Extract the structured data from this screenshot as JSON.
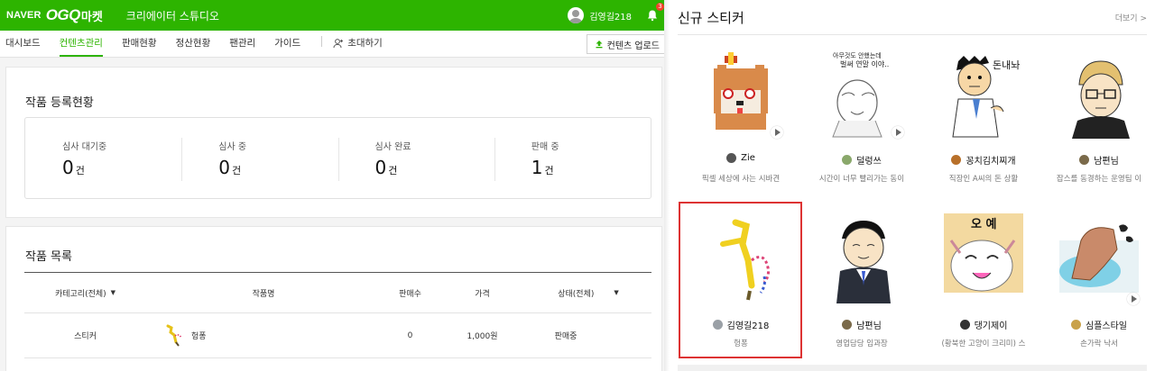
{
  "header": {
    "logo_naver": "NAVER",
    "logo_ogq": "OGQ",
    "logo_market": "마켓",
    "studio_title": "크리에이터 스튜디오",
    "user_name": "김영길218",
    "notification_count": "3"
  },
  "nav": {
    "items": [
      "대시보드",
      "컨텐츠관리",
      "판매현황",
      "정산현황",
      "팬관리",
      "가이드"
    ],
    "active": "컨텐츠관리",
    "invite": "초대하기",
    "upload": "컨텐츠 업로드"
  },
  "status": {
    "title": "작품 등록현황",
    "stats": [
      {
        "label": "심사 대기중",
        "value": "0",
        "unit": "건"
      },
      {
        "label": "심사 중",
        "value": "0",
        "unit": "건"
      },
      {
        "label": "심사 완료",
        "value": "0",
        "unit": "건"
      },
      {
        "label": "판매 중",
        "value": "1",
        "unit": "건"
      }
    ]
  },
  "works": {
    "title": "작품 목록",
    "columns": [
      "카테고리(전체)",
      "작품명",
      "판매수",
      "가격",
      "상태(전체)"
    ],
    "rows": [
      {
        "category": "스티커",
        "name": "헝퐁",
        "sales": "0",
        "price": "1,000원",
        "status": "판매중"
      }
    ]
  },
  "new_stickers": {
    "title": "신규 스티커",
    "more": "더보기 >",
    "items": [
      {
        "author": "Zie",
        "desc": "픽셀 세상에 사는 시바견",
        "avatar_color": "#555555"
      },
      {
        "author": "덜렁쓰",
        "desc": "시간이 너무 빨리가는 동이",
        "avatar_color": "#8aa86b"
      },
      {
        "author": "꽁치김치찌개",
        "desc": "직장인 A씨의 돈 상활",
        "avatar_color": "#b8702a"
      },
      {
        "author": "남편님",
        "desc": "잡스를 동경하는 운영팀 이",
        "avatar_color": "#7a6a4a"
      },
      {
        "author": "김영길218",
        "desc": "헝퐁",
        "avatar_color": "#9aa0a6"
      },
      {
        "author": "남편님",
        "desc": "영업담당 임과장",
        "avatar_color": "#7a6a4a"
      },
      {
        "author": "댕기제이",
        "desc": "(황북한 고양이 크리미) 스",
        "avatar_color": "#333333"
      },
      {
        "author": "심플스타일",
        "desc": "손가락 낙서",
        "avatar_color": "#c9a24a"
      }
    ]
  },
  "sticker_text": {
    "hint_line1": "아무것도 안했는데",
    "hint_line2": "벌써 연말 이야..",
    "money": "돈내놔",
    "oye": "오 예"
  },
  "colors": {
    "brand_green": "#2db400",
    "highlight_red": "#dd3333"
  }
}
